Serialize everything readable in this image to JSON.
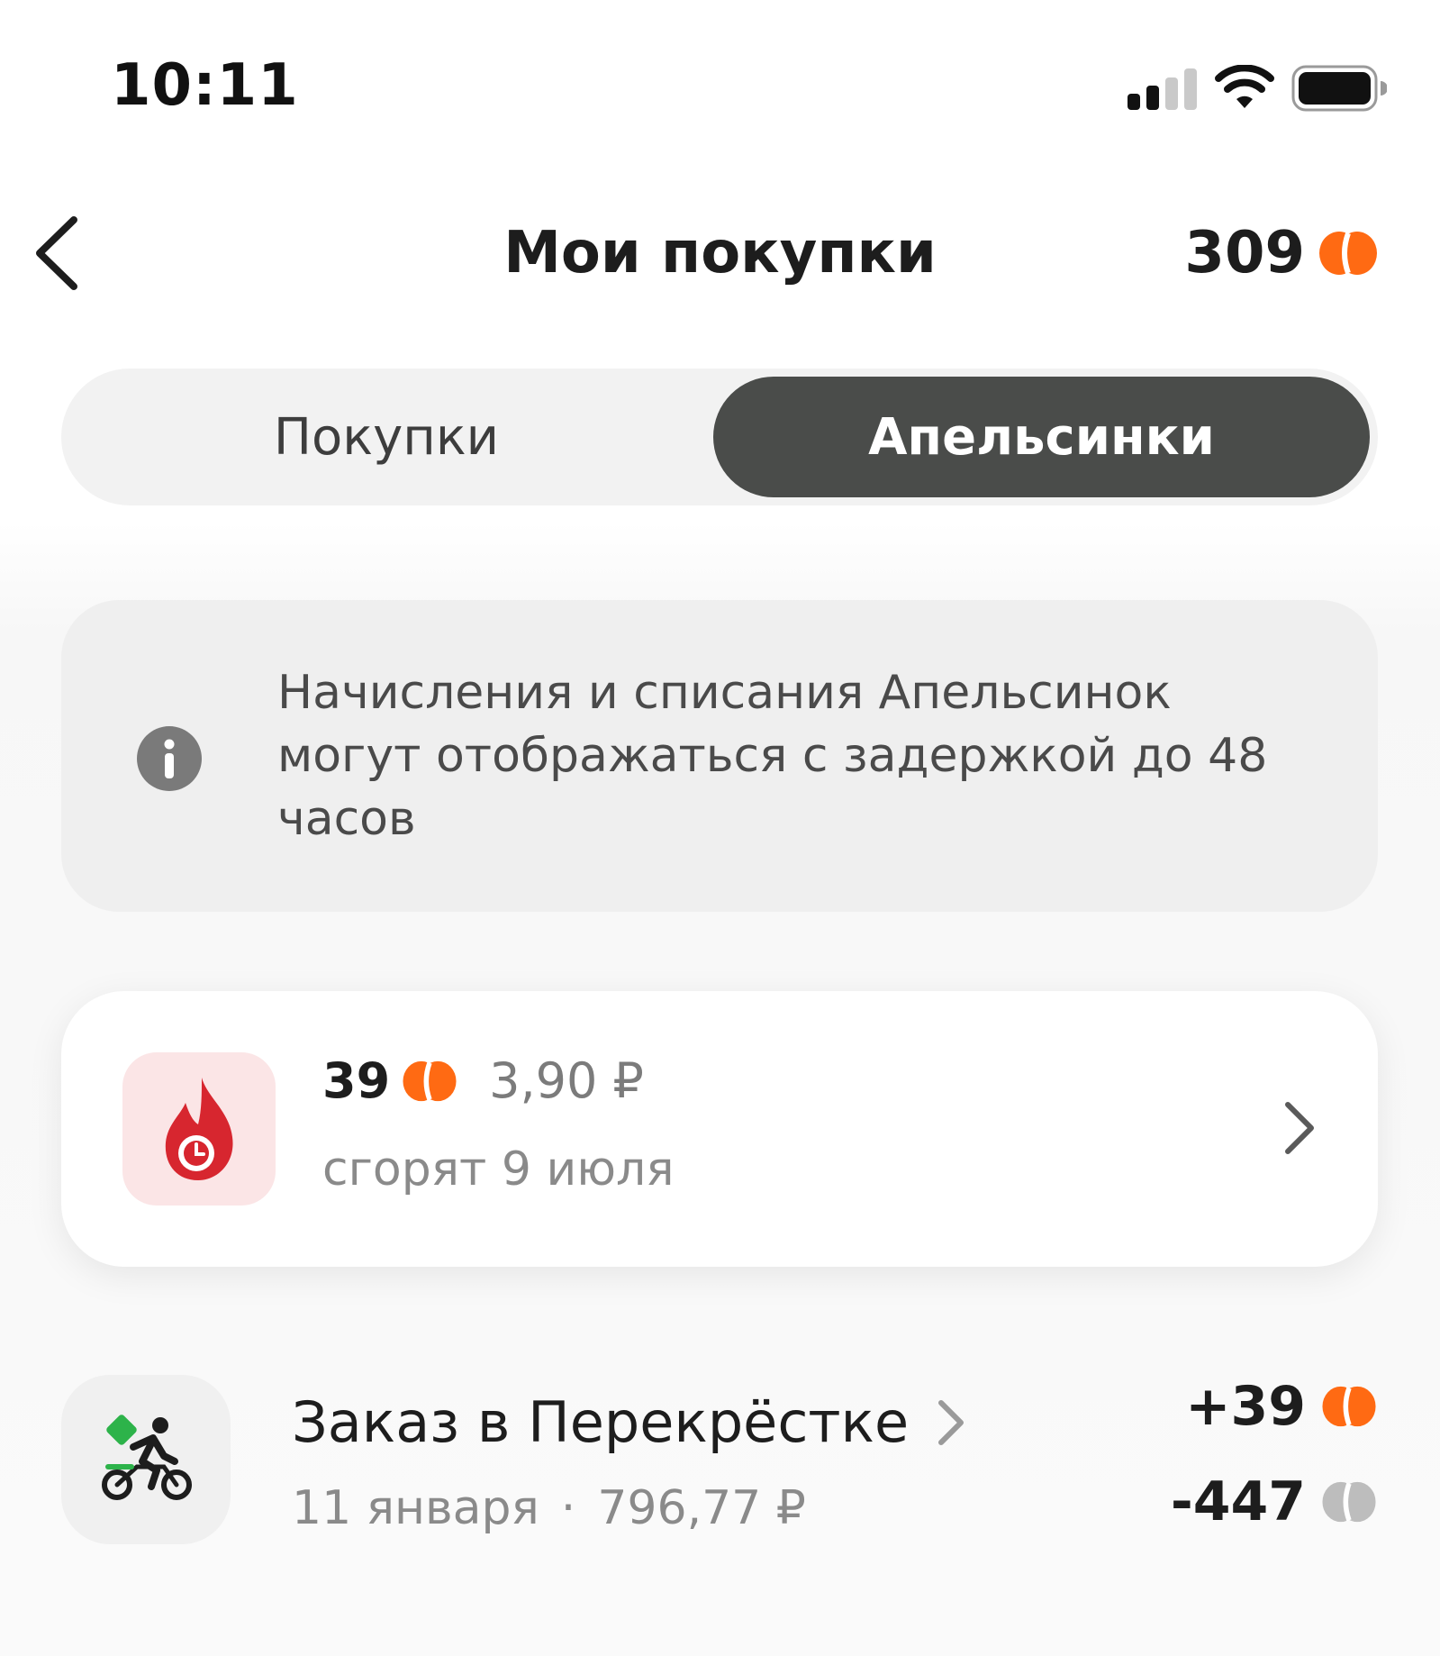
{
  "status_bar": {
    "time": "10:11"
  },
  "header": {
    "title": "Мои покупки",
    "balance": "309",
    "balance_icon": "orange-coin-icon"
  },
  "tabs": [
    {
      "label": "Покупки",
      "active": false
    },
    {
      "label": "Апельсинки",
      "active": true
    }
  ],
  "info_notice": {
    "text": "Начисления и списания Апельсинок могут отображаться с задержкой до 48 часов",
    "icon": "info-icon"
  },
  "expiring": {
    "points": "39",
    "money": "3,90 ₽",
    "date_text": "сгорят 9 июля",
    "icon": "fire-clock-icon"
  },
  "transactions": [
    {
      "title": "Заказ в Перекрёстке",
      "date": "11 января",
      "separator": "·",
      "amount": "796,77 ₽",
      "earned": "+39",
      "spent": "-447",
      "icon": "courier-bike-icon"
    }
  ],
  "colors": {
    "accent_orange": "#FF6A13",
    "active_tab_bg": "#4A4C4A",
    "fire_tile_bg": "#FBE5E6",
    "fire_red": "#D7262F",
    "courier_green": "#2DB34A",
    "spent_coin_gray": "#BDBDBD"
  }
}
